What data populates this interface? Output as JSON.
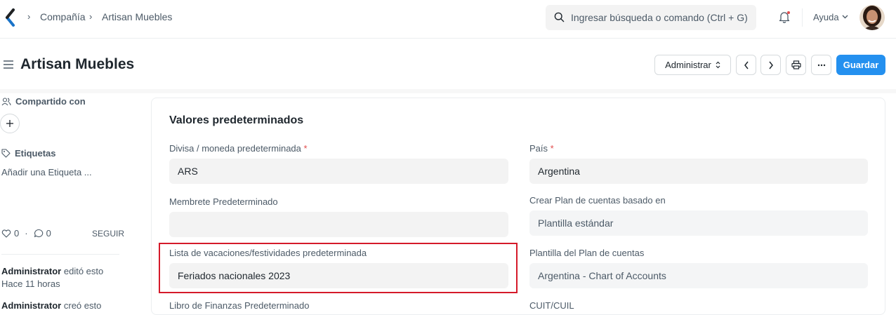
{
  "navbar": {
    "breadcrumbs": [
      {
        "label": "Compañía"
      },
      {
        "label": "Artisan Muebles"
      }
    ],
    "search_placeholder": "Ingresar búsqueda o comando (Ctrl + G)",
    "help_label": "Ayuda",
    "icons": [
      "app-logo-icon",
      "search-icon",
      "bell-icon",
      "chevron-down-icon"
    ]
  },
  "page_head": {
    "title": "Artisan Muebles",
    "actions_label": "Administrar",
    "save_label": "Guardar",
    "icons": [
      "menu-icon",
      "prev-icon",
      "next-icon",
      "print-icon",
      "more-icon"
    ]
  },
  "sidebar": {
    "shared_with_label": "Compartido con",
    "tags_label": "Etiquetas",
    "add_tag_label": "Añadir una Etiqueta ...",
    "likes_count": "0",
    "comments_count": "0",
    "follow_label": "SEGUIR",
    "activity": [
      {
        "user": "Administrator",
        "action": "editó esto",
        "time": "Hace 11 horas"
      },
      {
        "user": "Administrator",
        "action": "creó esto"
      }
    ]
  },
  "form": {
    "section_title": "Valores predeterminados",
    "fields": {
      "currency": {
        "label": "Divisa / moneda predeterminada",
        "required": "*",
        "value": "ARS"
      },
      "country": {
        "label": "País",
        "required": "*",
        "value": "Argentina"
      },
      "letterhead": {
        "label": "Membrete Predeterminado",
        "value": ""
      },
      "coa_based_on": {
        "label": "Crear Plan de cuentas basado en",
        "value": "Plantilla estándar"
      },
      "holiday_list": {
        "label": "Lista de vacaciones/festividades predeterminada",
        "value": "Feriados nacionales 2023"
      },
      "coa_template": {
        "label": "Plantilla del Plan de cuentas",
        "value": "Argentina - Chart of Accounts"
      },
      "finance_book": {
        "label": "Libro de Finanzas Predeterminado"
      },
      "tax_id": {
        "label": "CUIT/CUIL"
      }
    }
  },
  "colors": {
    "primary": "#2490ef",
    "required": "#e24c4c",
    "highlight": "#d51a2a",
    "field_bg": "#f3f3f3"
  }
}
